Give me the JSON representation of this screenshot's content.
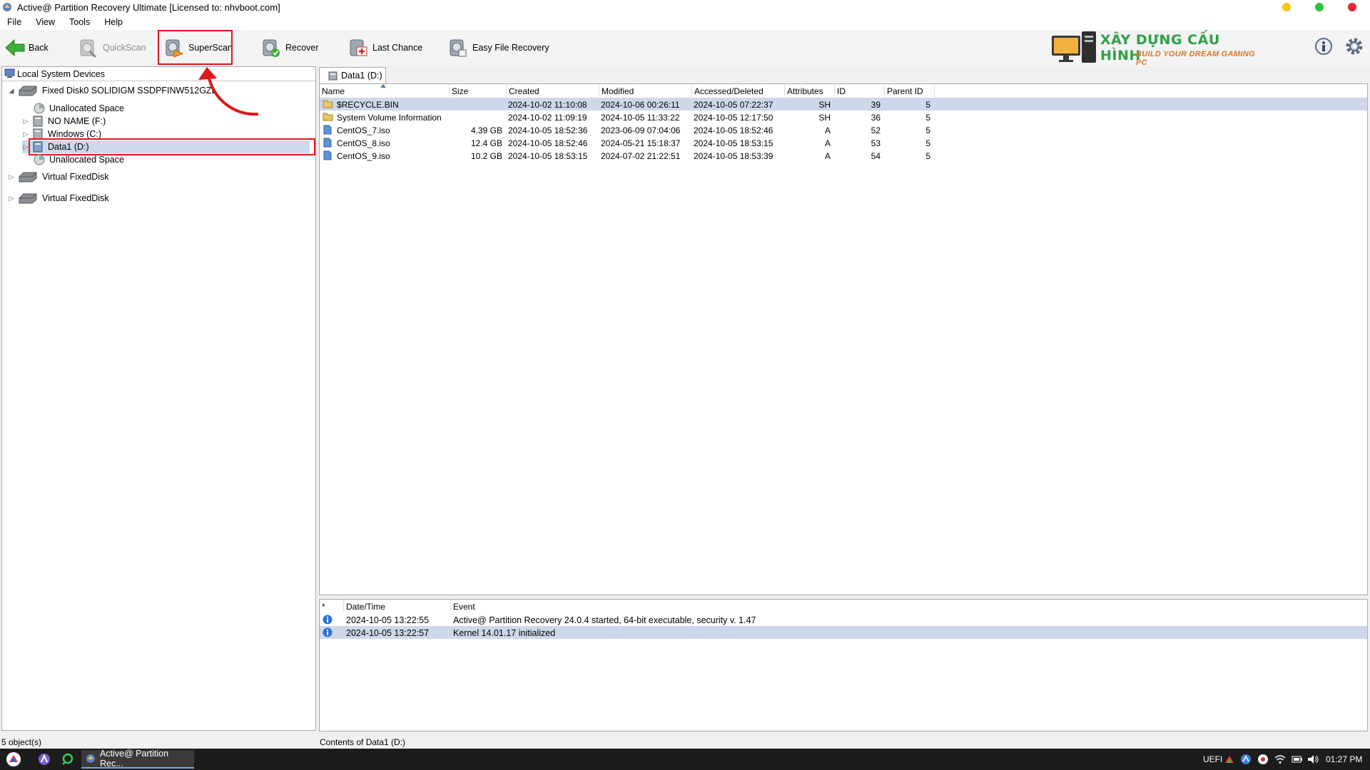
{
  "window": {
    "title": "Active@ Partition Recovery Ultimate [Licensed to: nhvboot.com]"
  },
  "menu": [
    "File",
    "View",
    "Tools",
    "Help"
  ],
  "toolbar": {
    "back": "Back",
    "quickscan": "QuickScan",
    "superscan": "SuperScan",
    "recover": "Recover",
    "last_chance": "Last Chance",
    "easy_file_recovery": "Easy File Recovery"
  },
  "logo": {
    "line1": "XÂY DỰNG CẤU HÌNH",
    "line2": "BUILD YOUR DREAM GAMING PC"
  },
  "tree": {
    "header": "Local System Devices",
    "items": [
      {
        "label": "Fixed Disk0 SOLIDIGM SSDPFINW512GZL"
      },
      {
        "label": "Unallocated Space"
      },
      {
        "label": "NO NAME (F:)"
      },
      {
        "label": "Windows (C:)"
      },
      {
        "label": "Data1 (D:)"
      },
      {
        "label": "Unallocated Space"
      },
      {
        "label": "Virtual FixedDisk"
      },
      {
        "label": "Virtual FixedDisk"
      }
    ]
  },
  "tab": {
    "label": "Data1 (D:)"
  },
  "files": {
    "columns": [
      "Name",
      "Size",
      "Created",
      "Modified",
      "Accessed/Deleted",
      "Attributes",
      "ID",
      "Parent ID"
    ],
    "rows": [
      {
        "name": "$RECYCLE.BIN",
        "size": "",
        "created": "2024-10-02 11:10:08",
        "modified": "2024-10-06 00:26:11",
        "accessed": "2024-10-05 07:22:37",
        "attr": "SH",
        "id": "39",
        "parent": "5",
        "type": "folder"
      },
      {
        "name": "System Volume Information",
        "size": "",
        "created": "2024-10-02 11:09:19",
        "modified": "2024-10-05 11:33:22",
        "accessed": "2024-10-05 12:17:50",
        "attr": "SH",
        "id": "36",
        "parent": "5",
        "type": "folder"
      },
      {
        "name": "CentOS_7.iso",
        "size": "4.39 GB",
        "created": "2024-10-05 18:52:36",
        "modified": "2023-06-09 07:04:06",
        "accessed": "2024-10-05 18:52:46",
        "attr": "A",
        "id": "52",
        "parent": "5",
        "type": "file"
      },
      {
        "name": "CentOS_8.iso",
        "size": "12.4 GB",
        "created": "2024-10-05 18:52:46",
        "modified": "2024-05-21 15:18:37",
        "accessed": "2024-10-05 18:53:15",
        "attr": "A",
        "id": "53",
        "parent": "5",
        "type": "file"
      },
      {
        "name": "CentOS_9.iso",
        "size": "10.2 GB",
        "created": "2024-10-05 18:53:15",
        "modified": "2024-07-02 21:22:51",
        "accessed": "2024-10-05 18:53:39",
        "attr": "A",
        "id": "54",
        "parent": "5",
        "type": "file"
      }
    ]
  },
  "log": {
    "columns": [
      "*",
      "Date/Time",
      "Event"
    ],
    "rows": [
      {
        "datetime": "2024-10-05 13:22:55",
        "event": "Active@ Partition Recovery 24.0.4 started, 64-bit executable, security v. 1.47"
      },
      {
        "datetime": "2024-10-05 13:22:57",
        "event": "Kernel 14.01.17 initialized"
      }
    ]
  },
  "status": {
    "left": "5 object(s)",
    "right": "Contents of Data1 (D:)"
  },
  "taskbar": {
    "task_label": "Active@ Partition Rec...",
    "tray_label": "UEFI",
    "clock": "01:27 PM"
  },
  "colors": {
    "highlight_red": "#e0161b",
    "selection": "#cdd9ea"
  }
}
